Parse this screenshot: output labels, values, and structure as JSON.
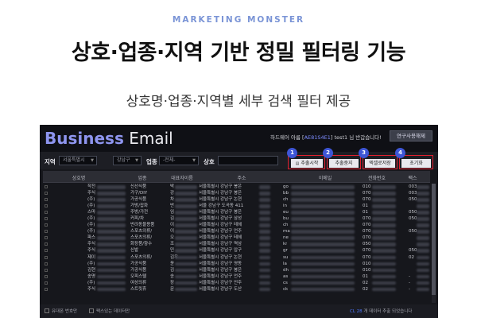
{
  "banner": {
    "brand": "MARKETING MONSTER",
    "headline": "상호·업종·지역 기반 정밀 필터링 기능",
    "subline": "상호명·업종·지역별 세부 검색 필터 제공"
  },
  "app": {
    "logo_bold": "Business",
    "logo_rest": " Email",
    "user_prefix": "하드웨어 아름 [",
    "hardware_id": "AE81S4E1",
    "user_mid": "] test1 님 반갑습니다!",
    "top_button": "연구사용해제"
  },
  "filters": {
    "region_label": "지역",
    "region_value": "서울특별시",
    "district_value": "강남구",
    "industry_label": "업종",
    "industry_value": "-전체-",
    "company_label": "상호"
  },
  "actions": [
    {
      "number": "1",
      "label": "추출시작",
      "icon": "document-icon"
    },
    {
      "number": "2",
      "label": "추출중지",
      "icon": ""
    },
    {
      "number": "3",
      "label": "엑셀로저장",
      "icon": ""
    },
    {
      "number": "4",
      "label": "초기화",
      "icon": ""
    }
  ],
  "table": {
    "columns": [
      "상호명",
      "업종",
      "대표자이름",
      "주소",
      "이메일",
      "전화번호",
      "팩스"
    ],
    "rows": [
      {
        "name": "작전",
        "industry": "신선식품",
        "rep": "박",
        "address": "서울특별시 강남구 봉은",
        "email": "go",
        "phone": "010",
        "fax": "003"
      },
      {
        "name": "주식",
        "industry": "가구/DIY",
        "rep": "강",
        "address": "서울특별시 강남구 봉은",
        "email": "bb",
        "phone": "070",
        "fax": "003"
      },
      {
        "name": "(주)",
        "industry": "가공식품",
        "rep": "차",
        "address": "서울특별시 강남구 논현",
        "email": "ch",
        "phone": "070",
        "fax": "050"
      },
      {
        "name": "(주)",
        "industry": "가방/잡화",
        "rep": "반",
        "address": "서울 강남구 도곡동 411",
        "email": "in",
        "phone": "01",
        "fax": ""
      },
      {
        "name": "스마",
        "industry": "주방/가전",
        "rep": "임",
        "address": "서울특별시 강남구 봉은",
        "email": "eu",
        "phone": "01",
        "fax": "050"
      },
      {
        "name": "(주)",
        "industry": "커피/차",
        "rep": "김",
        "address": "서울특별시 강남구 삼성",
        "email": "bu",
        "phone": "070",
        "fax": "050"
      },
      {
        "name": "(주)",
        "industry": "반려동물용품",
        "rep": "이",
        "address": "서울특별시 강남구 테헤",
        "email": "ch",
        "phone": "070",
        "fax": ""
      },
      {
        "name": "(주)",
        "industry": "스포츠의류/",
        "rep": "이",
        "address": "서울특별시 강남구 언주",
        "email": "ma",
        "phone": "070",
        "fax": "050"
      },
      {
        "name": "파스",
        "industry": "스포츠의류/",
        "rep": "오",
        "address": "서울특별시 강남구 테헤",
        "email": "ne",
        "phone": "070",
        "fax": ""
      },
      {
        "name": "주식",
        "industry": "화장품/향수",
        "rep": "조",
        "address": "서울특별시 강남구 역삼",
        "email": "kr",
        "phone": "050",
        "fax": ""
      },
      {
        "name": "주식",
        "industry": "신발",
        "rep": "민",
        "address": "서울특별시 강남구 압구",
        "email": "gr",
        "phone": "070",
        "fax": "050"
      },
      {
        "name": "제이",
        "industry": "스포츠의류/",
        "rep": "김우",
        "address": "서울특별시 강남구 논현",
        "email": "su",
        "phone": "070",
        "fax": "02"
      },
      {
        "name": "(주)",
        "industry": "가공식품",
        "rep": "윤",
        "address": "서울특별시 강남구 영동",
        "email": "la",
        "phone": "010",
        "fax": ""
      },
      {
        "name": "김현",
        "industry": "가공식품",
        "rep": "김",
        "address": "서울특별시 강남구 봉은",
        "email": "dh",
        "phone": "010",
        "fax": ""
      },
      {
        "name": "송명",
        "industry": "오피스텔",
        "rep": "송",
        "address": "서울특별시 강남구 언주",
        "email": "as",
        "phone": "01",
        "fax": "-"
      },
      {
        "name": "(주)",
        "industry": "여성의류",
        "rep": "장",
        "address": "서울특별시 강남구 언주",
        "email": "cs",
        "phone": "02",
        "fax": "-"
      },
      {
        "name": "주식",
        "industry": "스트릿휴",
        "rep": "문",
        "address": "서울특별시 강남구 도산",
        "email": "ck",
        "phone": "02",
        "fax": "-"
      }
    ]
  },
  "footer": {
    "check1_label": "유대폰 번호만",
    "check2_label": "팩스있는 데이터만",
    "status_prefix": "CL",
    "status_count": "28",
    "status_text": "개 데이터 추출 되었습니다"
  },
  "colors": {
    "accent_blue": "#3e56d6",
    "highlight_red": "#e0202f",
    "app_background": "#16171c"
  }
}
